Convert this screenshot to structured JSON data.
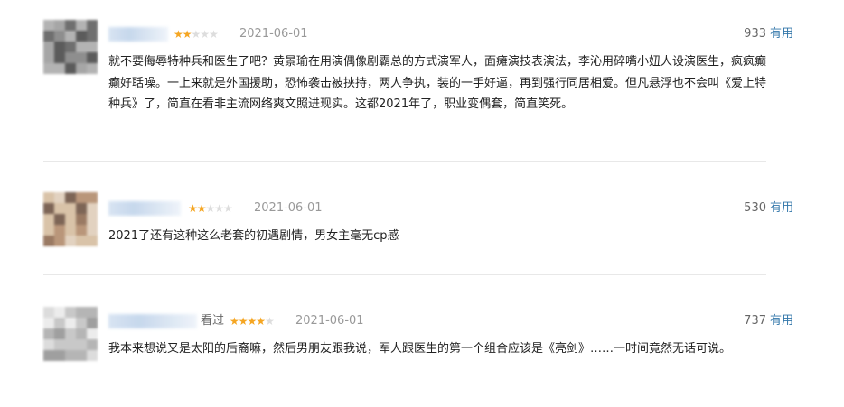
{
  "reviews": [
    {
      "username": "",
      "status": "",
      "rating": 2,
      "date": "2021-06-01",
      "votes": "933",
      "useful_label": "有用",
      "content": "就不要侮辱特种兵和医生了吧？黄景瑜在用演偶像剧霸总的方式演军人，面瘫演技表演法，李沁用碎嘴小妞人设演医生，疯疯癫癫好聒噪。一上来就是外国援助，恐怖袭击被挟持，两人争执，装的一手好逼，再到强行同居相爱。但凡悬浮也不会叫《爱上特种兵》了，简直在看非主流网络爽文照进现实。这都2021年了，职业变偶套，简直笑死。"
    },
    {
      "username": "",
      "status": "",
      "rating": 2,
      "date": "2021-06-01",
      "votes": "530",
      "useful_label": "有用",
      "content": "2021了还有这种这么老套的初遇剧情，男女主毫无cp感"
    },
    {
      "username": "",
      "status": "看过",
      "rating": 4,
      "date": "2021-06-01",
      "votes": "737",
      "useful_label": "有用",
      "content": "我本来想说又是太阳的后裔嘛，然后男朋友跟我说，军人跟医生的第一个组合应该是《亮剑》……一时间竟然无话可说。"
    }
  ]
}
